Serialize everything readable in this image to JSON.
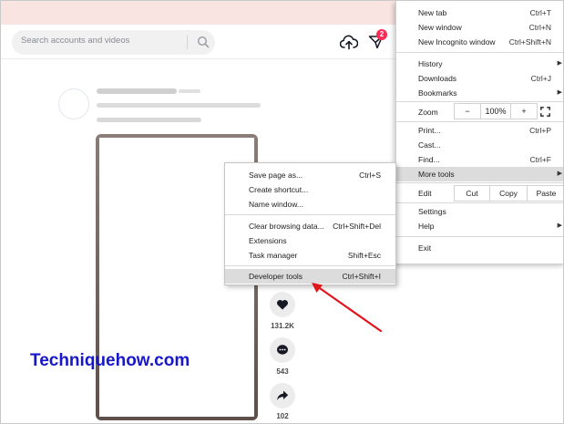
{
  "search": {
    "placeholder": "Search accounts and videos"
  },
  "header": {
    "inbox_badge": "2"
  },
  "video": {
    "likes": "131.2K",
    "comments": "543",
    "shares": "102"
  },
  "watermark": "Techniquehow.com",
  "chrome_menu": {
    "new_tab": {
      "label": "New tab",
      "shortcut": "Ctrl+T"
    },
    "new_window": {
      "label": "New window",
      "shortcut": "Ctrl+N"
    },
    "new_incognito": {
      "label": "New Incognito window",
      "shortcut": "Ctrl+Shift+N"
    },
    "history": {
      "label": "History"
    },
    "downloads": {
      "label": "Downloads",
      "shortcut": "Ctrl+J"
    },
    "bookmarks": {
      "label": "Bookmarks"
    },
    "zoom": {
      "label": "Zoom",
      "minus": "−",
      "value": "100%",
      "plus": "+"
    },
    "print": {
      "label": "Print...",
      "shortcut": "Ctrl+P"
    },
    "cast": {
      "label": "Cast..."
    },
    "find": {
      "label": "Find...",
      "shortcut": "Ctrl+F"
    },
    "more_tools": {
      "label": "More tools"
    },
    "edit": {
      "label": "Edit",
      "cut": "Cut",
      "copy": "Copy",
      "paste": "Paste"
    },
    "settings": {
      "label": "Settings"
    },
    "help": {
      "label": "Help"
    },
    "exit": {
      "label": "Exit"
    }
  },
  "more_tools_menu": {
    "save_page": {
      "label": "Save page as...",
      "shortcut": "Ctrl+S"
    },
    "create_shortcut": {
      "label": "Create shortcut..."
    },
    "name_window": {
      "label": "Name window..."
    },
    "clear_data": {
      "label": "Clear browsing data...",
      "shortcut": "Ctrl+Shift+Del"
    },
    "extensions": {
      "label": "Extensions"
    },
    "task_manager": {
      "label": "Task manager",
      "shortcut": "Shift+Esc"
    },
    "developer_tools": {
      "label": "Developer tools",
      "shortcut": "Ctrl+Shift+I"
    }
  },
  "colors": {
    "accent_red": "#fe2c55",
    "arrow_red": "#e0161c",
    "watermark_blue": "#1717c9",
    "highlight": "#dcdcdc"
  }
}
